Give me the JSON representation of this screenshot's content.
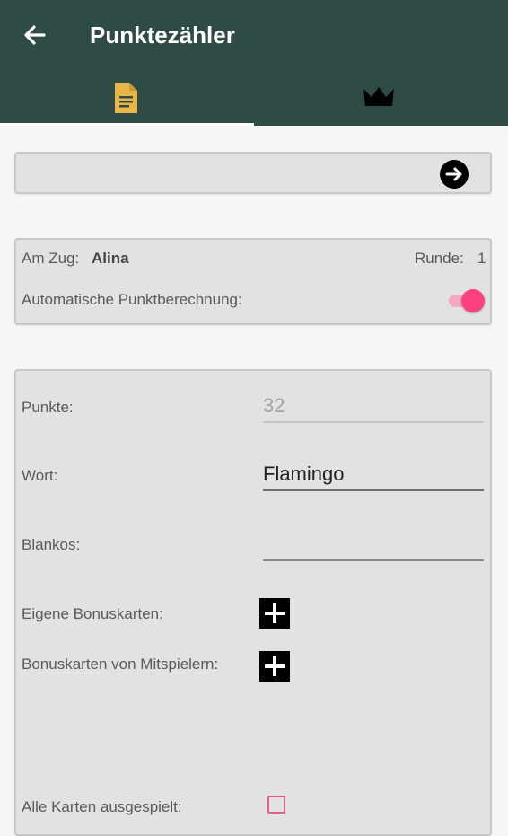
{
  "app": {
    "title": "Punktezähler",
    "colors": {
      "toolbar": "#2f4b45",
      "accent": "#ff4081",
      "tab_icon_active": "#e9b64a"
    }
  },
  "toolbar": {
    "back_icon": "arrow-left-icon"
  },
  "tabs": [
    {
      "icon": "document-icon",
      "active": true
    },
    {
      "icon": "crown-icon",
      "active": false
    }
  ],
  "top_box": {
    "next_icon": "arrow-right-circle-icon"
  },
  "status": {
    "turn_label": "Am Zug:",
    "turn_player": "Alina",
    "round_label": "Runde:",
    "round_value": "1",
    "auto_label": "Automatische Punktberechnung:",
    "auto_enabled": true
  },
  "form": {
    "points_label": "Punkte:",
    "points_value": "32",
    "word_label": "Wort:",
    "word_value": "Flamingo",
    "blanks_label": "Blankos:",
    "blanks_value": "",
    "own_bonus_label": "Eigene Bonuskarten:",
    "other_bonus_label": "Bonuskarten von Mitspielern:",
    "all_cards_label": "Alle Karten ausgespielt:",
    "all_cards_checked": false
  }
}
